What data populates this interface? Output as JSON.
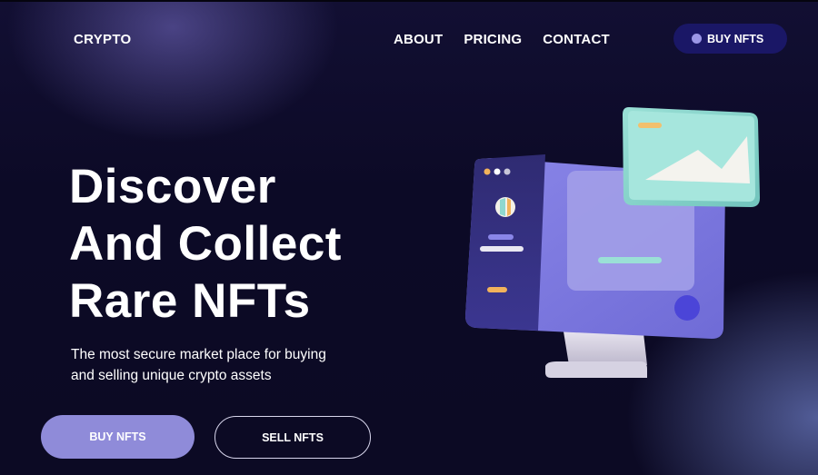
{
  "header": {
    "logo": "CRYPTO",
    "nav": [
      "ABOUT",
      "PRICING",
      "CONTACT"
    ],
    "cta_label": "BUY NFTS"
  },
  "hero": {
    "title_lines": [
      "Discover",
      "And Collect",
      "Rare NFTs"
    ],
    "subtitle_lines": [
      "The most secure market place for buying",
      "and selling unique crypto assets"
    ],
    "primary_button": "BUY NFTS",
    "secondary_button": "SELL NFTS"
  },
  "illustration": {
    "icons": [
      "monitor-icon",
      "image-card-icon"
    ]
  },
  "colors": {
    "background": "#0c0a26",
    "accent": "#8f8bd9",
    "header_button": "#1a1766",
    "monitor_panel": "#7f7be0",
    "image_card": "#8fd8cf"
  }
}
